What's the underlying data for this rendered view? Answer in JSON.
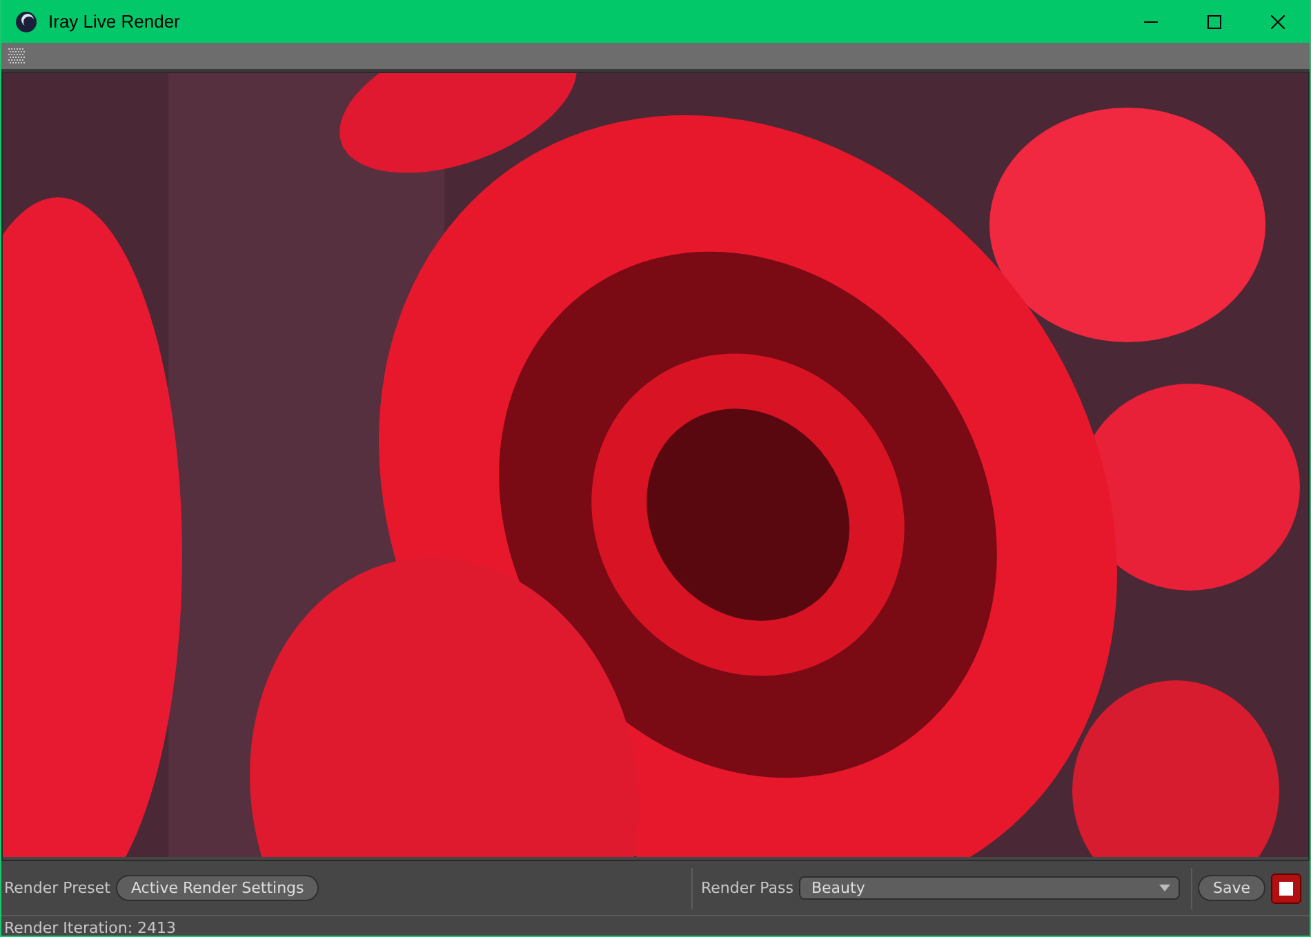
{
  "window": {
    "title": "Iray Live Render"
  },
  "controls": {
    "preset_label": "Render Preset",
    "preset_button": "Active Render Settings",
    "pass_label": "Render Pass",
    "pass_value": "Beauty",
    "save_button": "Save"
  },
  "status_bar": {
    "text": "Render Iteration: 2413"
  }
}
